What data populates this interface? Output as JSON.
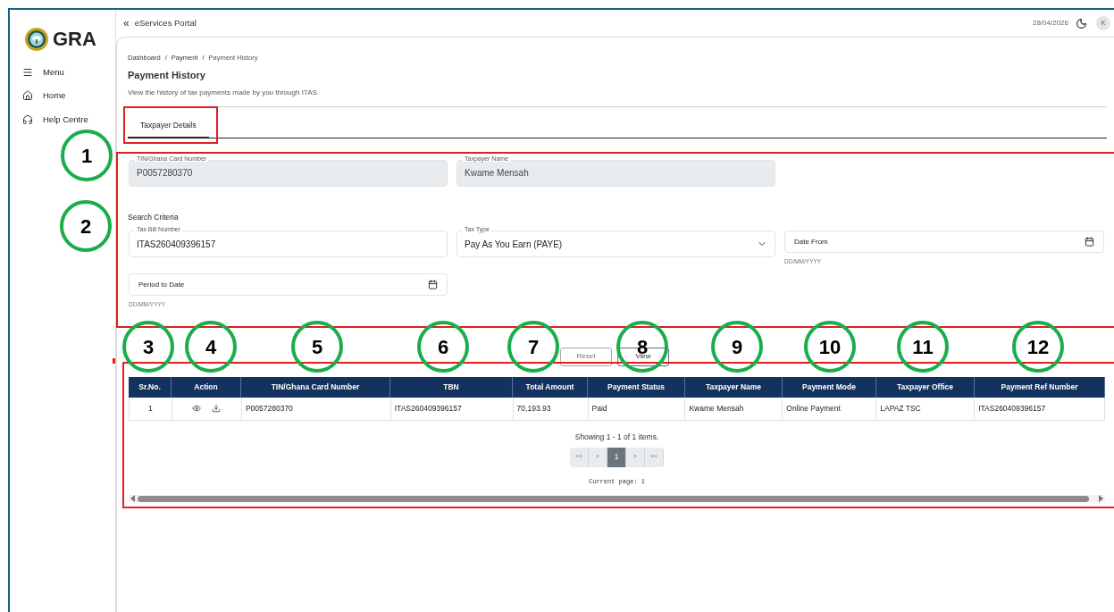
{
  "header": {
    "collapse": "«",
    "portal_title": "eServices Portal",
    "date": "28/04/2026",
    "avatar": "K"
  },
  "logo": {
    "text": "GRA"
  },
  "sidebar": {
    "items": [
      {
        "label": "Menu"
      },
      {
        "label": "Home"
      },
      {
        "label": "Help Centre"
      }
    ]
  },
  "breadcrumb": {
    "separator": "/",
    "items": [
      "Dashboard",
      "Payment",
      "Payment History"
    ]
  },
  "page": {
    "title": "Payment History",
    "description": "View the history of tax payments made by you through ITAS."
  },
  "tabs": [
    {
      "label": "Taxpayer Details",
      "selected": true
    }
  ],
  "taxpayer_fields": [
    {
      "label": "TIN/Ghana Card Number",
      "value": "P0057280370",
      "disabled": true
    },
    {
      "label": "Taxpayer Name",
      "value": "Kwame Mensah",
      "disabled": true
    }
  ],
  "search_criteria": {
    "title": "Search Criteria",
    "fields": [
      {
        "kind": "text",
        "label": "Tax Bill Number",
        "value": "ITAS260409396157"
      },
      {
        "kind": "select",
        "label": "Tax Type",
        "value": "Pay As You Earn (PAYE)"
      },
      {
        "kind": "date",
        "placeholder": "Date From",
        "hint": "DD/MM/YYYY"
      },
      {
        "kind": "date",
        "placeholder": "Period to Date",
        "hint": "DD/MM/YYYY"
      }
    ]
  },
  "buttons": [
    "Reset",
    "View"
  ],
  "table": {
    "columns": [
      {
        "label": "Sr.No.",
        "kind": "text"
      },
      {
        "label": "Action",
        "kind": "actions"
      },
      {
        "label": "TIN/Ghana Card Number",
        "kind": "text"
      },
      {
        "label": "TBN",
        "kind": "text"
      },
      {
        "label": "Total Amount",
        "kind": "text"
      },
      {
        "label": "Payment Status",
        "kind": "text"
      },
      {
        "label": "Taxpayer Name",
        "kind": "text"
      },
      {
        "label": "Payment Mode",
        "kind": "text"
      },
      {
        "label": "Taxpayer Office",
        "kind": "text"
      },
      {
        "label": "Payment Ref Number",
        "kind": "text"
      }
    ],
    "rows": [
      {
        "cells": [
          "1",
          "",
          "P0057280370",
          "ITAS260409396157",
          "70,193.93",
          "Paid",
          "Kwame Mensah",
          "Online Payment",
          "LAPAZ TSC",
          "ITAS260409396157"
        ]
      }
    ]
  },
  "pagination": {
    "summary": "Showing 1 - 1 of 1 items.",
    "buttons": [
      {
        "label": "««",
        "selected": false
      },
      {
        "label": "«",
        "selected": false
      },
      {
        "label": "1",
        "selected": true
      },
      {
        "label": "»",
        "selected": false
      },
      {
        "label": "»»",
        "selected": false
      }
    ],
    "current_page": "Current page: 1"
  },
  "callouts": [
    {
      "number": "1"
    },
    {
      "number": "2"
    },
    {
      "number": "3"
    },
    {
      "number": "4"
    },
    {
      "number": "5"
    },
    {
      "number": "6"
    },
    {
      "number": "7"
    },
    {
      "number": "8"
    },
    {
      "number": "9"
    },
    {
      "number": "10"
    },
    {
      "number": "11"
    },
    {
      "number": "12"
    }
  ]
}
